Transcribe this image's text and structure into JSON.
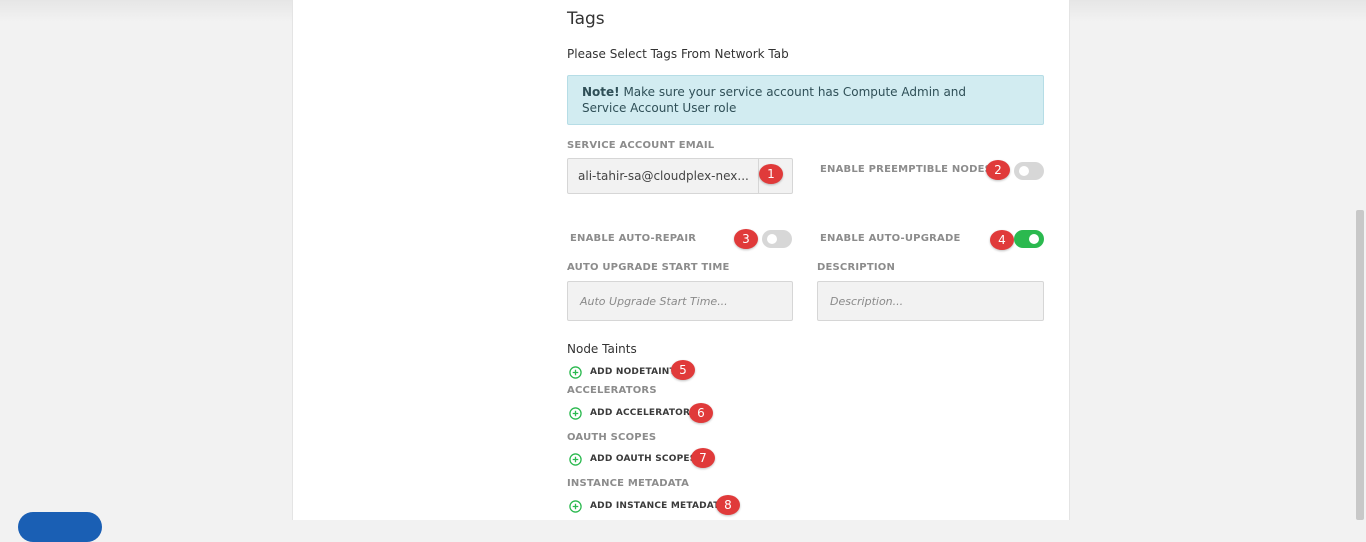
{
  "form": {
    "title": "Tags",
    "subtitle": "Please Select Tags From Network Tab",
    "note": {
      "strong": "Note!",
      "text": " Make sure your service account has Compute Admin and Service Account User role"
    },
    "service_account_email": {
      "label": "SERVICE ACCOUNT EMAIL",
      "value": "ali-tahir-sa@cloudplex-nex..."
    },
    "preemptible": {
      "label": "ENABLE PREEMPTIBLE NODES",
      "enabled": false
    },
    "auto_repair": {
      "label": "ENABLE AUTO-REPAIR",
      "enabled": false
    },
    "auto_upgrade": {
      "label": "ENABLE AUTO-UPGRADE",
      "enabled": true
    },
    "auto_upgrade_start_time": {
      "label": "AUTO UPGRADE START TIME",
      "placeholder": "Auto Upgrade Start Time..."
    },
    "description": {
      "label": "DESCRIPTION",
      "placeholder": "Description..."
    },
    "node_taints": {
      "heading": "Node Taints",
      "add_label": "ADD NODETAINT"
    },
    "accelerators": {
      "heading": "ACCELERATORS",
      "add_label": "ADD ACCELERATORS"
    },
    "oauth_scopes": {
      "heading": "OAUTH SCOPES",
      "add_label": "ADD OAUTH SCOPES"
    },
    "instance_metadata": {
      "heading": "INSTANCE METADATA",
      "add_label": "ADD INSTANCE METADATA"
    }
  },
  "annotations": [
    "1",
    "2",
    "3",
    "4",
    "5",
    "6",
    "7",
    "8"
  ],
  "colors": {
    "accent_green": "#2bb94f",
    "badge_red": "#e03a3a",
    "note_bg": "#d2ecf1"
  },
  "icons": {
    "add": "plus-circle-icon"
  }
}
